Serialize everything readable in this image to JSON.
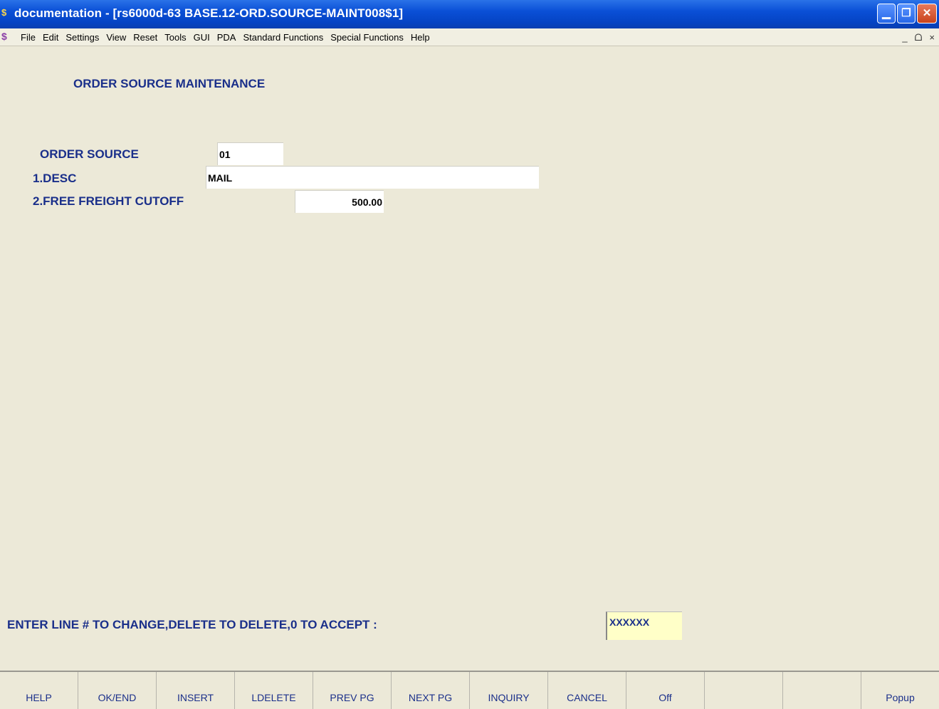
{
  "window": {
    "title": "documentation - [rs6000d-63 BASE.12-ORD.SOURCE-MAINT008$1]",
    "controls": {
      "minimize": "minimize-icon",
      "restore": "restore-icon",
      "close": "close-icon"
    }
  },
  "menu": {
    "items": [
      "File",
      "Edit",
      "Settings",
      "View",
      "Reset",
      "Tools",
      "GUI",
      "PDA",
      "Standard Functions",
      "Special Functions",
      "Help"
    ],
    "mdi_controls": [
      "_",
      "ᗝ",
      "×"
    ]
  },
  "screen": {
    "heading": "ORDER SOURCE MAINTENANCE",
    "fields": {
      "order_source": {
        "label": "ORDER SOURCE",
        "value": "01"
      },
      "desc": {
        "label": "1.DESC",
        "value": "MAIL"
      },
      "free_freight": {
        "label": "2.FREE FREIGHT CUTOFF",
        "value": "500.00"
      }
    },
    "prompt": "ENTER LINE # TO CHANGE,DELETE TO DELETE,0 TO ACCEPT  :",
    "command_input": "XXXXXX"
  },
  "function_keys": [
    "HELP",
    "OK/END",
    "INSERT",
    "LDELETE",
    "PREV PG",
    "NEXT PG",
    "INQUIRY",
    "CANCEL",
    "Off",
    "",
    "",
    "Popup"
  ],
  "colors": {
    "label": "#1a2f8a",
    "titlebar": "#0a4fd6",
    "background": "#ece9d8",
    "command_bg": "#ffffc8"
  }
}
